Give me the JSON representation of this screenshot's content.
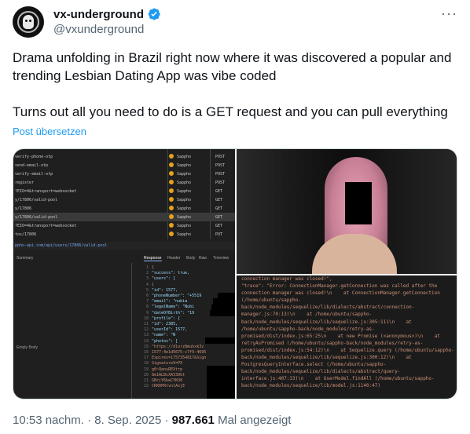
{
  "author": {
    "display_name": "vx-underground",
    "handle": "@vxunderground"
  },
  "menu_icon": "more-icon",
  "tweet": {
    "paragraphs": [
      "Drama unfolding in Brazil right now where it was discovered a popular and trending Lesbian Dating App was vibe coded",
      "Turns out all you need to do is a GET request and you can pull everything"
    ],
    "translate_label": "Post übersetzen"
  },
  "colors": {
    "accent": "#1d9bf0",
    "verified": "#1d9bf0",
    "text": "#0f1419",
    "secondary": "#536471"
  },
  "media": {
    "network_rows": [
      {
        "name": "verify-phone-otp",
        "initiator": "Sappho",
        "method": "POST"
      },
      {
        "name": "send-email-otp",
        "initiator": "Sappho",
        "method": "POST"
      },
      {
        "name": "verify-email-otp",
        "initiator": "Sappho",
        "method": "POST"
      },
      {
        "name": "register",
        "initiator": "Sappho",
        "method": "POST"
      },
      {
        "name": "?EIO=4&transport=websocket",
        "initiator": "Sappho",
        "method": "GET"
      },
      {
        "name": "y/17806/valid-pool",
        "initiator": "Sappho",
        "method": "GET"
      },
      {
        "name": "y/17806",
        "initiator": "Sappho",
        "method": "GET"
      },
      {
        "name": "y/17806/valid-pool",
        "initiator": "Sappho",
        "method": "GET"
      },
      {
        "name": "?EIO=4&transport=websocket",
        "initiator": "Sappho",
        "method": "GET"
      },
      {
        "name": "tos/17806",
        "initiator": "Sappho",
        "method": "PUT"
      }
    ],
    "url": "ppho-api.com/api/users/17806/valid-pool",
    "tabs": [
      "Summary",
      "Response",
      "Header",
      "Body",
      "Raw",
      "Treeview"
    ],
    "empty_body": "Empty Body",
    "code_lines": [
      "{",
      "\"success\": true,",
      "\"users\": [",
      "{",
      "\"id\": 1577,",
      "\"phoneNumber\": \"+5519",
      "\"email\": \"nubia",
      "\"legalName\": \"Nubi",
      "\"dateOfBirth\": \"19",
      "\"profile\": {",
      "\"id\": 2385,",
      "\"userId\": 1577,",
      "\"name\": \"N",
      "\"photos\": [",
      "\"https://dlurz8muhxk3z",
      "1577-4e1d5675-c7f9-4695",
      "Expires=1757354817&Sign",
      "SignatureV=PX",
      "g0~QanuREXtrp",
      "8e1ALBsXA339Gt",
      "GBrjY6kwCYKU8",
      "CKR0PRtvnlAxjE"
    ],
    "log_text": "connection manager was closed!\",\n\"trace\": \"Error: ConnectionManager.getConnection was called after the connection manager was closed!\\n    at ConnectionManager.getConnection (/home/ubuntu/sappho-back/node_modules/sequelize/lib/dialects/abstract/connection-manager.js:70:13)\\n    at /home/ubuntu/sappho-back/node_modules/sequelize/lib/sequelize.js:305:111\\n    at /home/ubuntu/sappho-back/node_modules/retry-as-promised/dist/index.js:65:25\\n    at new Promise (<anonymous>)\\n    at retryAsPromised (/home/ubuntu/sappho-back/node_modules/retry-as-promised/dist/index.js:54:12)\\n    at Sequelize.query (/home/ubuntu/sappho-back/node_modules/sequelize/lib/sequelize.js:300:12)\\n    at PostgresQueryInterface.select (/home/ubuntu/sappho-back/node_modules/sequelize/lib/dialects/abstract/query-interface.js:407:33)\\n    at UserModel.findAll (/home/ubuntu/sappho-back/node_modules/sequelize/lib/model.js:1140:47)"
  },
  "footer": {
    "time": "10:53 nachm.",
    "separator": "·",
    "date": "8. Sep. 2025",
    "views_count": "987.661",
    "views_label": "Mal angezeigt"
  }
}
